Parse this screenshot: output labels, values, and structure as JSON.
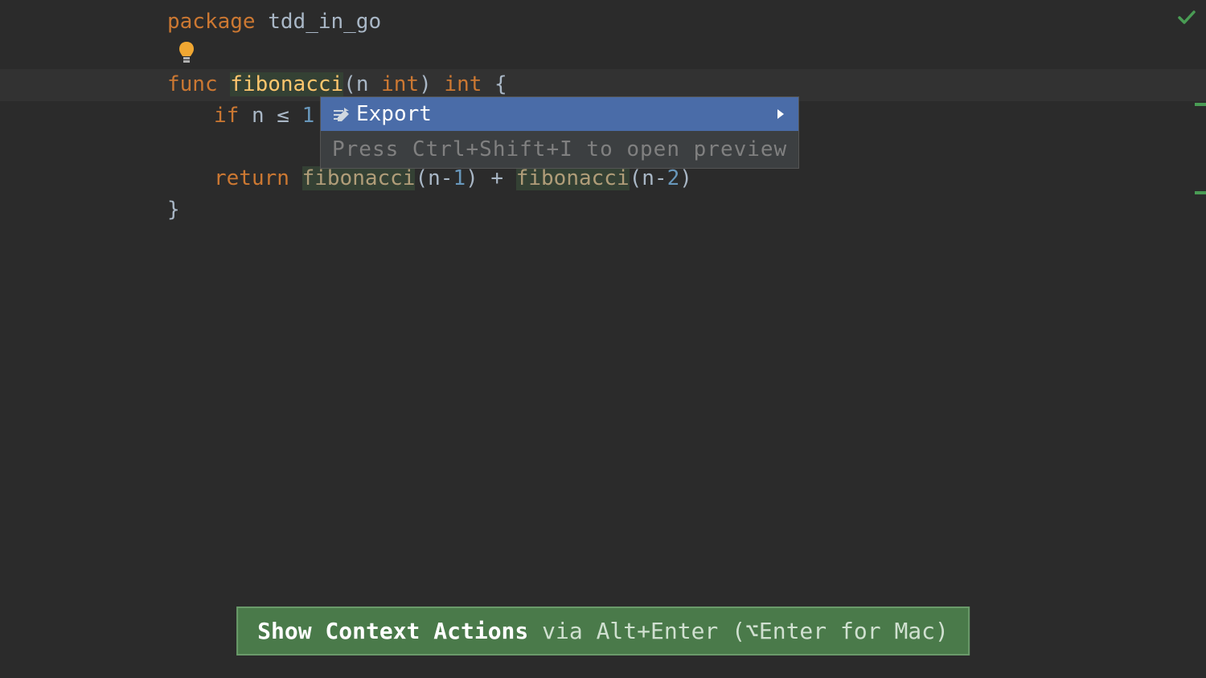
{
  "code": {
    "line1": {
      "package_kw": "package",
      "package_name": "tdd_in_go"
    },
    "line3": {
      "func_kw": "func",
      "func_name": "fibonacci",
      "param_name": "n",
      "param_type": "int",
      "return_type": "int"
    },
    "line4": {
      "if_kw": "if",
      "var": "n",
      "op": "≤",
      "val": "1"
    },
    "line6": {
      "return_kw": "return",
      "call1": "fibonacci",
      "arg1_var": "n",
      "arg1_num": "1",
      "plus": "+",
      "call2": "fibonacci",
      "arg2_var": "n",
      "arg2_num": "2"
    }
  },
  "popup": {
    "export_label": "Export",
    "hint": "Press Ctrl+Shift+I to open preview"
  },
  "banner": {
    "strong": "Show Context Actions",
    "rest_prefix": " via Alt+Enter (",
    "mac_key": "⌥Enter",
    "rest_suffix": " for Mac)"
  }
}
